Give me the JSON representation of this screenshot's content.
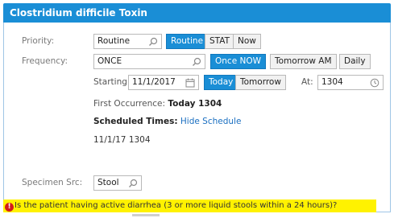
{
  "header": {
    "title": "Clostridium difficile Toxin"
  },
  "priority": {
    "label": "Priority:",
    "value": "Routine",
    "options": [
      "Routine",
      "STAT",
      "Now"
    ],
    "selected": "Routine"
  },
  "frequency": {
    "label": "Frequency:",
    "value": "ONCE",
    "options": [
      "Once NOW",
      "Tomorrow AM",
      "Daily"
    ],
    "selected": "Once NOW"
  },
  "starting": {
    "label": "Starting:",
    "date": "11/1/2017",
    "options": [
      "Today",
      "Tomorrow"
    ],
    "selected": "Today",
    "at_label": "At:",
    "time": "1304"
  },
  "first_occurrence": {
    "label": "First Occurrence:",
    "value": "Today 1304"
  },
  "scheduled_times": {
    "label": "Scheduled Times:",
    "link": "Hide Schedule",
    "entry": "11/1/17 1304"
  },
  "specimen": {
    "label": "Specimen Src:",
    "value": "Stool"
  },
  "warning": {
    "icon": "alert-icon",
    "text": "Is the patient having active diarrhea (3 or more liquid stools within a 24 hours)?"
  },
  "colors": {
    "accent": "#1a8ed6",
    "warning_bg": "#fff200",
    "alert": "#d21b1b"
  }
}
